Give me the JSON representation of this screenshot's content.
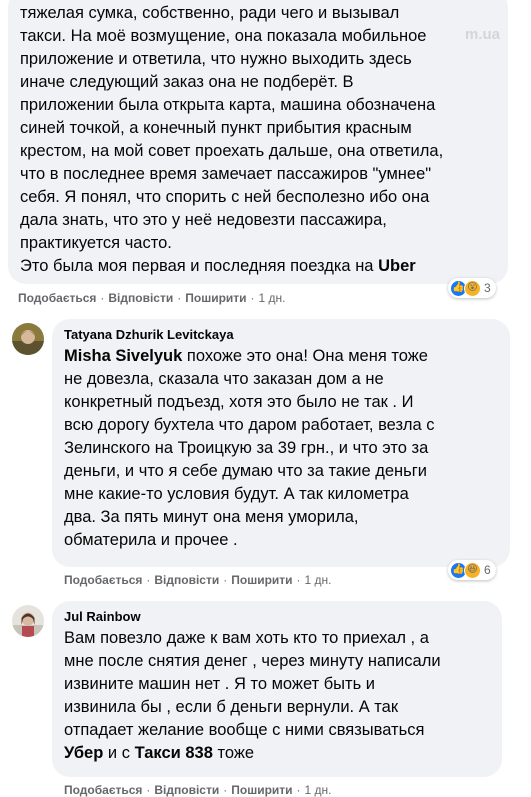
{
  "comment1": {
    "lines": [
      "тяжелая сумка, собственно, ради чего и вызывал",
      "такси. На моё возмущение, она показала мобильное",
      "приложение и ответила, что нужно выходить здесь",
      "иначе следующий заказ она не подберёт. В",
      "приложении была открыта карта, машина обозначена",
      "синей точкой, а конечный пункт прибытия красным",
      "крестом, на мой совет проехать дальше, она ответила,",
      "что в последнее время замечает пассажиров \"умнее\"",
      "себя. Я понял, что спорить с ней бесполезно ибо она",
      "дала знать, что это у неё недовезти пассажира,",
      "практикуется часто."
    ],
    "last_line_prefix": "Это была моя первая и последняя поездка на",
    "last_line_bold": "Uber",
    "like_label": "Подобається",
    "reply_label": "Відповісти",
    "share_label": "Поширити",
    "time": "1 дн.",
    "reaction_count": "3",
    "watermark": "m.ua"
  },
  "comment2": {
    "author": "Tatyana Dzhurik Levitckaya",
    "mention": "Misha Sivelyuk",
    "first_line_rest": "похоже это она! Она меня тоже",
    "lines": [
      "не довезла, сказала что заказан дом а не",
      "конкретный подъезд, хотя это было не так . И",
      "всю дорогу бухтела что даром работает, везла с",
      "Зелинского на Троицкую за 39 грн., и что это за",
      "деньги, и что я себе думаю что за такие деньги",
      "мне какие-то условия будут. А так километра",
      "два. За пять минут она меня уморила,",
      "обматерила и прочее ."
    ],
    "like_label": "Подобається",
    "reply_label": "Відповісти",
    "share_label": "Поширити",
    "time": "1 дн.",
    "reaction_count": "6"
  },
  "comment3": {
    "author": "Jul Rainbow",
    "lines": [
      "Вам повезло даже к вам хоть кто то приехал , а",
      "мне после снятия денег , через минуту написали",
      "извините машин нет . Я то может быть и",
      "извинила бы , если б деньги вернули. А так",
      "отпадает желание вообще с ними связываться"
    ],
    "last_bold1": "Убер",
    "last_mid": "и с",
    "last_bold2": "Такси 838",
    "last_end": "тоже",
    "like_label": "Подобається",
    "reply_label": "Відповісти",
    "share_label": "Поширити",
    "time": "1 дн."
  }
}
